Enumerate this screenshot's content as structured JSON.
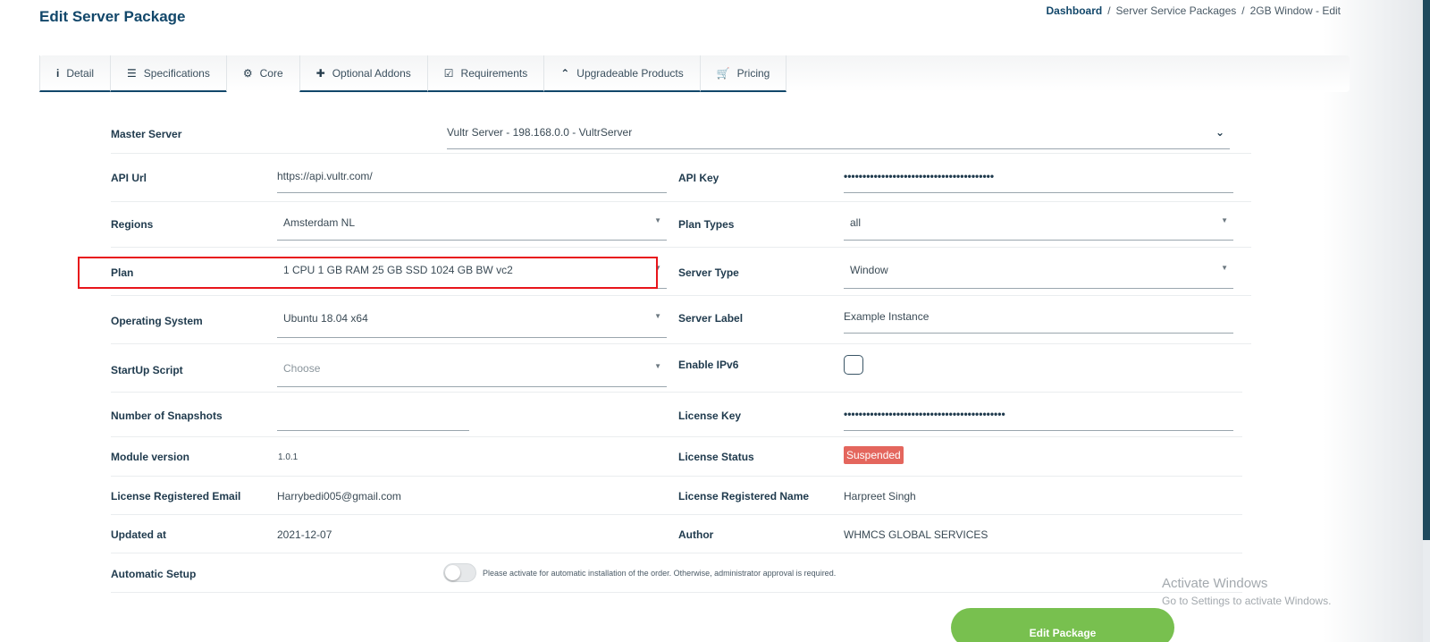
{
  "page": {
    "title": "Edit Server Package",
    "breadcrumb": [
      "Dashboard",
      "Server Service Packages",
      "2GB Window - Edit"
    ]
  },
  "tabs": [
    {
      "label": "Detail",
      "icon": "info-icon",
      "glyph": "i"
    },
    {
      "label": "Specifications",
      "icon": "list-icon",
      "glyph": "☰"
    },
    {
      "label": "Core",
      "icon": "cogs-icon",
      "glyph": "⚙"
    },
    {
      "label": "Optional Addons",
      "icon": "plus-icon",
      "glyph": "✚"
    },
    {
      "label": "Requirements",
      "icon": "check-square-icon",
      "glyph": "☑"
    },
    {
      "label": "Upgradeable Products",
      "icon": "double-chevron-up-icon",
      "glyph": "⌃"
    },
    {
      "label": "Pricing",
      "icon": "cart-icon",
      "glyph": "🛒"
    }
  ],
  "active_tab": "Core",
  "form": {
    "master_server": {
      "label": "Master Server",
      "value": "Vultr Server - 198.168.0.0 - VultrServer"
    },
    "api_url": {
      "label": "API Url",
      "value": "https://api.vultr.com/"
    },
    "api_key": {
      "label": "API Key",
      "value": "••••••••••••••••••••••••••••••••••••••••"
    },
    "regions": {
      "label": "Regions",
      "value": "Amsterdam NL"
    },
    "plan_types": {
      "label": "Plan Types",
      "value": "all"
    },
    "plan": {
      "label": "Plan",
      "value": "1 CPU 1 GB RAM 25 GB SSD 1024 GB BW vc2"
    },
    "server_type": {
      "label": "Server Type",
      "value": "Window"
    },
    "operating_system": {
      "label": "Operating System",
      "value": "Ubuntu 18.04 x64"
    },
    "server_label": {
      "label": "Server Label",
      "value": "Example Instance"
    },
    "startup_script": {
      "label": "StartUp Script",
      "placeholder": "Choose"
    },
    "enable_ipv6": {
      "label": "Enable IPv6",
      "checked": false
    },
    "snapshots": {
      "label": "Number of Snapshots",
      "value": ""
    },
    "license_key": {
      "label": "License Key",
      "value": "•••••••••••••••••••••••••••••••••••••••••••"
    },
    "module_version": {
      "label": "Module version",
      "value": "1.0.1"
    },
    "license_status": {
      "label": "License Status",
      "value": "Suspended"
    },
    "license_email": {
      "label": "License Registered Email",
      "value": "Harrybedi005@gmail.com"
    },
    "license_name": {
      "label": "License Registered Name",
      "value": "Harpreet Singh"
    },
    "updated_at": {
      "label": "Updated at",
      "value": "2021-12-07"
    },
    "author": {
      "label": "Author",
      "value": "WHMCS GLOBAL SERVICES"
    },
    "automatic_setup": {
      "label": "Automatic Setup",
      "enabled": false,
      "hint": "Please activate for automatic installation of the order. Otherwise, administrator approval is required."
    }
  },
  "submit_label": "Edit Package",
  "watermark": {
    "line1": "Activate Windows",
    "line2": "Go to Settings to activate Windows."
  },
  "colors": {
    "accent": "#12476a",
    "submit": "#78c04f",
    "badge": "#e4665d",
    "highlight": "#e8151b"
  }
}
